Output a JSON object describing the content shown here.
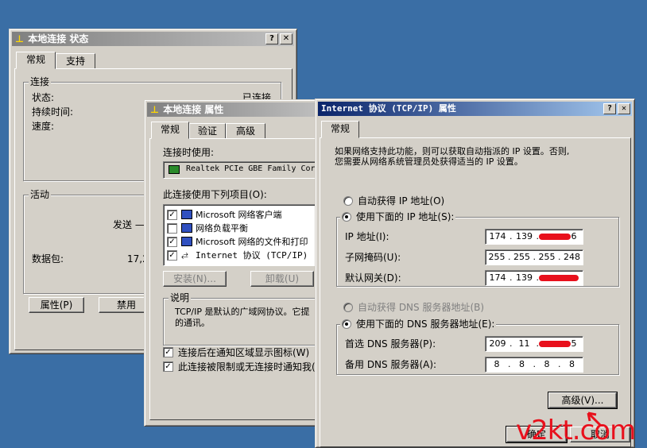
{
  "status_window": {
    "title": "本地连接 状态",
    "tabs": [
      "常规",
      "支持"
    ],
    "connection_group": "连接",
    "status_label": "状态:",
    "status_value": "已连接",
    "duration_label": "持续时间:",
    "speed_label": "速度:",
    "activity_group": "活动",
    "sent_label": "发送 —",
    "packets_label": "数据包:",
    "packets_value": "17,2",
    "properties_button": "属性(P)",
    "disable_button": "禁用"
  },
  "props_window": {
    "title": "本地连接 属性",
    "tabs": [
      "常规",
      "验证",
      "高级"
    ],
    "connect_using_label": "连接时使用:",
    "adapter": "Realtek PCIe GBE Family Cor",
    "items_label": "此连接使用下列项目(O):",
    "items": [
      {
        "checked": true,
        "label": "Microsoft 网络客户端"
      },
      {
        "checked": false,
        "label": "网络负载平衡"
      },
      {
        "checked": true,
        "label": "Microsoft 网络的文件和打印"
      },
      {
        "checked": true,
        "label": "Internet 协议 (TCP/IP)"
      }
    ],
    "install_button": "安装(N)...",
    "uninstall_button": "卸载(U)",
    "desc_group": "说明",
    "desc_text_1": "TCP/IP 是默认的广域网协议。它提",
    "desc_text_2": "的通讯。",
    "notify_icon_label": "连接后在通知区域显示图标(W)",
    "notify_limited_label": "此连接被限制或无连接时通知我("
  },
  "tcpip_window": {
    "title": "Internet 协议 (TCP/IP) 属性",
    "tab": "常规",
    "intro_1": "如果网络支持此功能，则可以获取自动指派的 IP 设置。否则,",
    "intro_2": "您需要从网络系统管理员处获得适当的 IP 设置。",
    "auto_ip_label": "自动获得 IP 地址(O)",
    "manual_ip_label": "使用下面的 IP 地址(S):",
    "ip_label": "IP 地址(I):",
    "ip_value": {
      "o1": "174",
      "o2": "139",
      "o4": "6"
    },
    "mask_label": "子网掩码(U):",
    "mask_value": {
      "o1": "255",
      "o2": "255",
      "o3": "255",
      "o4": "248"
    },
    "gateway_label": "默认网关(D):",
    "gateway_value": {
      "o1": "174",
      "o2": "139"
    },
    "auto_dns_label": "自动获得 DNS 服务器地址(B)",
    "manual_dns_label": "使用下面的 DNS 服务器地址(E):",
    "pref_dns_label": "首选 DNS 服务器(P):",
    "pref_dns_value": {
      "o1": "209",
      "o2": "11",
      "o4": "5"
    },
    "alt_dns_label": "备用 DNS 服务器(A):",
    "alt_dns_value": {
      "o1": "8",
      "o2": "8",
      "o3": "8",
      "o4": "8"
    },
    "advanced_button": "高级(V)...",
    "ok_button": "确定",
    "cancel_button": "取消"
  },
  "watermark": "v2kt.com",
  "colors": {
    "desktop": "#3a6ea5",
    "window_face": "#d4d0c8",
    "active_title": "#0a246a",
    "redaction": "#e8101c"
  }
}
